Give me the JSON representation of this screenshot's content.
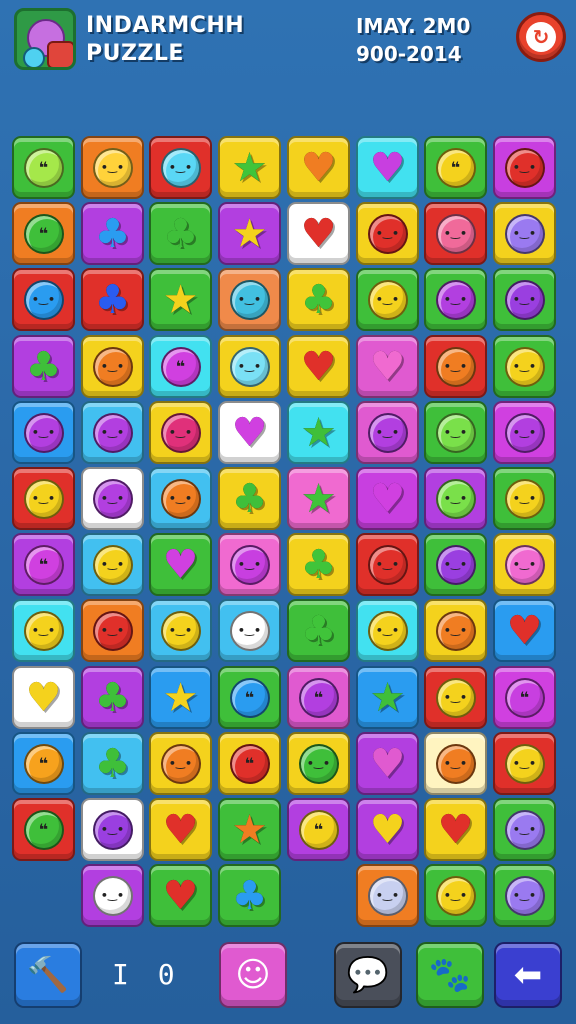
{
  "header": {
    "title_line1": "INDARMCHH",
    "title_line2": "PUZZLE",
    "date_line1": "IMAY. 2M0",
    "date_line2": "900-2014",
    "logo_icon": "game-logo-icon",
    "refresh_icon": "refresh-icon",
    "refresh_glyph": "↻"
  },
  "board": {
    "columns": 8,
    "rows": 12,
    "tiles": [
      [
        {
          "bg": "#3fbf3a",
          "fg": "#a5e84a",
          "shape": "bubble"
        },
        {
          "bg": "#f07d22",
          "fg": "#ffd23a",
          "shape": "face"
        },
        {
          "bg": "#e0302a",
          "fg": "#5ad7f5",
          "shape": "face"
        },
        {
          "bg": "#f4d21d",
          "fg": "#40c43a",
          "shape": "star"
        },
        {
          "bg": "#f4d21d",
          "fg": "#f07d22",
          "shape": "heart"
        },
        {
          "bg": "#42e1f0",
          "fg": "#c83fe0",
          "shape": "heart"
        },
        {
          "bg": "#3fbf3a",
          "fg": "#f4d21d",
          "shape": "bubble"
        },
        {
          "bg": "#c83fe0",
          "fg": "#e0302a",
          "shape": "face"
        }
      ],
      [
        {
          "bg": "#f07d22",
          "fg": "#3fbf3a",
          "shape": "bubble"
        },
        {
          "bg": "#b23fe0",
          "fg": "#2a9cf0",
          "shape": "leaf"
        },
        {
          "bg": "#3fbf3a",
          "fg": "#3fbf3a",
          "shape": "leaf"
        },
        {
          "bg": "#b23fe0",
          "fg": "#f4d21d",
          "shape": "star"
        },
        {
          "bg": "#ffffff",
          "fg": "#e0302a",
          "shape": "heart"
        },
        {
          "bg": "#f4d21d",
          "fg": "#e0302a",
          "shape": "face"
        },
        {
          "bg": "#e0302a",
          "fg": "#f06a9a",
          "shape": "face"
        },
        {
          "bg": "#f4d21d",
          "fg": "#9a7af0",
          "shape": "face"
        }
      ],
      [
        {
          "bg": "#e0302a",
          "fg": "#2a9cf0",
          "shape": "face"
        },
        {
          "bg": "#e0302a",
          "fg": "#2a5cf0",
          "shape": "leaf"
        },
        {
          "bg": "#3fbf3a",
          "fg": "#f4d21d",
          "shape": "star"
        },
        {
          "bg": "#f08a4a",
          "fg": "#42c0e0",
          "shape": "face"
        },
        {
          "bg": "#f4d21d",
          "fg": "#40c43a",
          "shape": "leaf"
        },
        {
          "bg": "#3fbf3a",
          "fg": "#f4d21d",
          "shape": "face"
        },
        {
          "bg": "#3fbf3a",
          "fg": "#b23fe0",
          "shape": "face"
        },
        {
          "bg": "#3fbf3a",
          "fg": "#9a3fe0",
          "shape": "face"
        }
      ],
      [
        {
          "bg": "#b23fe0",
          "fg": "#3fbf3a",
          "shape": "leaf"
        },
        {
          "bg": "#f4d21d",
          "fg": "#f07d22",
          "shape": "face"
        },
        {
          "bg": "#42e1f0",
          "fg": "#d040e0",
          "shape": "bubble"
        },
        {
          "bg": "#f4d21d",
          "fg": "#7ae0f5",
          "shape": "face"
        },
        {
          "bg": "#f4d21d",
          "fg": "#e0302a",
          "shape": "heart"
        },
        {
          "bg": "#e05ad0",
          "fg": "#f06ad0",
          "shape": "heart"
        },
        {
          "bg": "#e0302a",
          "fg": "#f07d22",
          "shape": "face"
        },
        {
          "bg": "#3fbf3a",
          "fg": "#f4d21d",
          "shape": "face"
        }
      ],
      [
        {
          "bg": "#2a9cf0",
          "fg": "#b23fe0",
          "shape": "face"
        },
        {
          "bg": "#42c0f0",
          "fg": "#b23fe0",
          "shape": "face"
        },
        {
          "bg": "#f4d21d",
          "fg": "#e0307a",
          "shape": "face"
        },
        {
          "bg": "#ffffff",
          "fg": "#d040e0",
          "shape": "heart"
        },
        {
          "bg": "#42e1f0",
          "fg": "#3fbf3a",
          "shape": "star"
        },
        {
          "bg": "#e05ad0",
          "fg": "#b23fe0",
          "shape": "face"
        },
        {
          "bg": "#3fbf3a",
          "fg": "#7ae04a",
          "shape": "face"
        },
        {
          "bg": "#d040e0",
          "fg": "#b23fe0",
          "shape": "face"
        }
      ],
      [
        {
          "bg": "#e0302a",
          "fg": "#f4d21d",
          "shape": "face"
        },
        {
          "bg": "#ffffff",
          "fg": "#b23fe0",
          "shape": "face"
        },
        {
          "bg": "#42c0f0",
          "fg": "#f07d22",
          "shape": "face"
        },
        {
          "bg": "#f4d21d",
          "fg": "#3fbf3a",
          "shape": "leaf"
        },
        {
          "bg": "#f06ad0",
          "fg": "#40c43a",
          "shape": "star"
        },
        {
          "bg": "#c83fe0",
          "fg": "#d040e0",
          "shape": "heart"
        },
        {
          "bg": "#b23fe0",
          "fg": "#7ae04a",
          "shape": "face"
        },
        {
          "bg": "#3fbf3a",
          "fg": "#f4d21d",
          "shape": "face"
        }
      ],
      [
        {
          "bg": "#b23fe0",
          "fg": "#d040e0",
          "shape": "bubble"
        },
        {
          "bg": "#42c0f0",
          "fg": "#f4d21d",
          "shape": "face"
        },
        {
          "bg": "#3fbf3a",
          "fg": "#d040e0",
          "shape": "heart"
        },
        {
          "bg": "#f06ad0",
          "fg": "#c83fe0",
          "shape": "face"
        },
        {
          "bg": "#f4d21d",
          "fg": "#40c43a",
          "shape": "leaf"
        },
        {
          "bg": "#e0302a",
          "fg": "#e0302a",
          "shape": "face"
        },
        {
          "bg": "#3fbf3a",
          "fg": "#9a3fe0",
          "shape": "face"
        },
        {
          "bg": "#f4d21d",
          "fg": "#f06ad0",
          "shape": "face"
        }
      ],
      [
        {
          "bg": "#42e1f0",
          "fg": "#f4d21d",
          "shape": "face"
        },
        {
          "bg": "#f07d22",
          "fg": "#e0302a",
          "shape": "face"
        },
        {
          "bg": "#42c0f0",
          "fg": "#f4d21d",
          "shape": "face"
        },
        {
          "bg": "#42c0f0",
          "fg": "#ffffff",
          "shape": "face"
        },
        {
          "bg": "#3fbf3a",
          "fg": "#40c43a",
          "shape": "leaf"
        },
        {
          "bg": "#42e1f0",
          "fg": "#f4d21d",
          "shape": "face"
        },
        {
          "bg": "#f4d21d",
          "fg": "#f07d22",
          "shape": "face"
        },
        {
          "bg": "#2a9cf0",
          "fg": "#e0302a",
          "shape": "heart"
        }
      ],
      [
        {
          "bg": "#ffffff",
          "fg": "#f4d21d",
          "shape": "heart"
        },
        {
          "bg": "#b23fe0",
          "fg": "#3fbf3a",
          "shape": "leaf"
        },
        {
          "bg": "#2a9cf0",
          "fg": "#f4d21d",
          "shape": "star"
        },
        {
          "bg": "#3fbf3a",
          "fg": "#2a9cf0",
          "shape": "bubble"
        },
        {
          "bg": "#e05ad0",
          "fg": "#b23fe0",
          "shape": "bubble"
        },
        {
          "bg": "#2a9cf0",
          "fg": "#3fbf3a",
          "shape": "star"
        },
        {
          "bg": "#e0302a",
          "fg": "#f4d21d",
          "shape": "face"
        },
        {
          "bg": "#d040e0",
          "fg": "#c83fe0",
          "shape": "bubble"
        }
      ],
      [
        {
          "bg": "#2a9cf0",
          "fg": "#f7a21d",
          "shape": "bubble"
        },
        {
          "bg": "#42c0f0",
          "fg": "#3fbf3a",
          "shape": "leaf"
        },
        {
          "bg": "#f4d21d",
          "fg": "#f07d22",
          "shape": "face"
        },
        {
          "bg": "#f4d21d",
          "fg": "#e0302a",
          "shape": "bubble"
        },
        {
          "bg": "#f4d21d",
          "fg": "#3fbf3a",
          "shape": "face"
        },
        {
          "bg": "#b23fe0",
          "fg": "#e05ad0",
          "shape": "heart"
        },
        {
          "bg": "#fff4c0",
          "fg": "#f07d22",
          "shape": "face"
        },
        {
          "bg": "#e0302a",
          "fg": "#f4d21d",
          "shape": "face"
        }
      ],
      [
        {
          "bg": "#e0302a",
          "fg": "#3fbf3a",
          "shape": "bubble"
        },
        {
          "bg": "#ffffff",
          "fg": "#9a3fe0",
          "shape": "face"
        },
        {
          "bg": "#f4d21d",
          "fg": "#e0302a",
          "shape": "heart"
        },
        {
          "bg": "#3fbf3a",
          "fg": "#f07d22",
          "shape": "star"
        },
        {
          "bg": "#b23fe0",
          "fg": "#f4d21d",
          "shape": "bubble"
        },
        {
          "bg": "#b23fe0",
          "fg": "#f4d21d",
          "shape": "heart"
        },
        {
          "bg": "#f4d21d",
          "fg": "#e0302a",
          "shape": "heart"
        },
        {
          "bg": "#3fbf3a",
          "fg": "#9a7af0",
          "shape": "face"
        }
      ],
      [
        null,
        {
          "bg": "#b23fe0",
          "fg": "#ffffff",
          "shape": "face"
        },
        {
          "bg": "#3fbf3a",
          "fg": "#e0302a",
          "shape": "heart"
        },
        {
          "bg": "#3fbf3a",
          "fg": "#2a9cf0",
          "shape": "leaf"
        },
        null,
        {
          "bg": "#f07d22",
          "fg": "#c8d0f0",
          "shape": "face"
        },
        {
          "bg": "#3fbf3a",
          "fg": "#f4d21d",
          "shape": "face"
        },
        {
          "bg": "#3fbf3a",
          "fg": "#9a7af0",
          "shape": "face"
        }
      ]
    ]
  },
  "bottom": {
    "hammer_button": {
      "icon": "hammer-icon",
      "glyph": "🔨",
      "bg": "#2a7de0"
    },
    "moves_count": "I 0",
    "fluff_button": {
      "icon": "fluffy-creature-icon",
      "glyph": "☺",
      "bg": "#e05ad0"
    },
    "chat_button": {
      "icon": "chat-bubble-icon",
      "glyph": "💬",
      "bg": "#4a4f5a"
    },
    "pet_button": {
      "icon": "pet-icon",
      "glyph": "🐾",
      "bg": "#3fbf3a"
    },
    "back_button": {
      "icon": "back-arrow-icon",
      "glyph": "⬅",
      "bg": "#3a3fd0"
    }
  }
}
